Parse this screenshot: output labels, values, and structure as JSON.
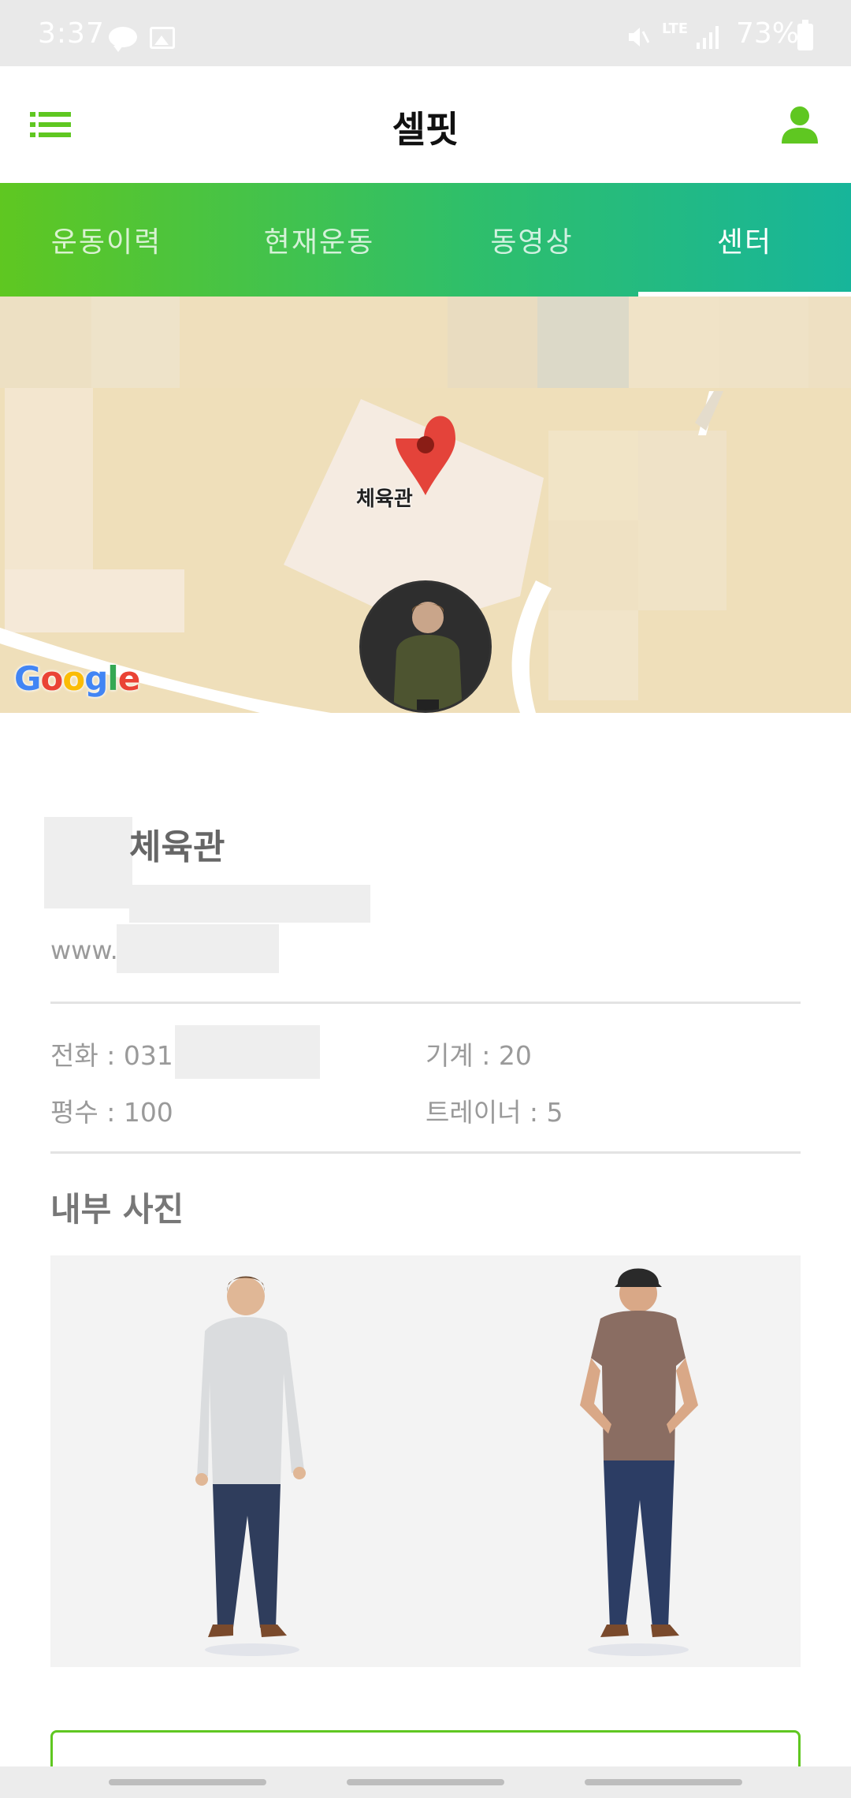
{
  "status_bar": {
    "time": "3:37",
    "network": "LTE",
    "battery": "73%",
    "icons": [
      "kakaotalk-icon",
      "gallery-icon",
      "mute-icon",
      "signal-icon",
      "battery-icon"
    ]
  },
  "header": {
    "title": "셀핏",
    "menu_icon": "list-menu-icon",
    "profile_icon": "person-icon",
    "accent_color": "#5fc721"
  },
  "tabs": [
    {
      "label": "운동이력",
      "active": false
    },
    {
      "label": "현재운동",
      "active": false
    },
    {
      "label": "동영상",
      "active": false
    },
    {
      "label": "센터",
      "active": true
    }
  ],
  "map": {
    "pin_label": "체육관",
    "attribution": {
      "g1": "G",
      "o1": "o",
      "o2": "o",
      "g2": "g",
      "l": "l",
      "e": "e"
    }
  },
  "center": {
    "name": "체육관",
    "url": "www.",
    "phone": "전화 : 031",
    "machines": "기계 : 20",
    "area": "평수 : 100",
    "trainers": "트레이너 : 5"
  },
  "gallery": {
    "title": "내부 사진",
    "photos": [
      "man-in-white-shirt",
      "man-in-brown-tshirt"
    ]
  }
}
